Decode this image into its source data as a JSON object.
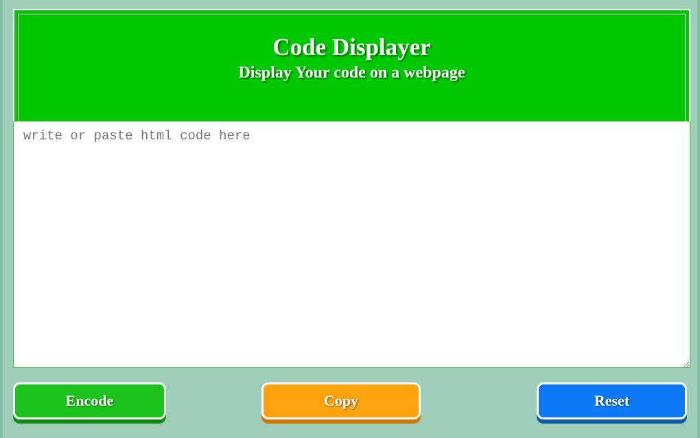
{
  "header": {
    "title": "Code Displayer",
    "subtitle": "Display Your code on a webpage"
  },
  "editor": {
    "placeholder": "write or paste html code here",
    "value": ""
  },
  "buttons": {
    "encode_label": "Encode",
    "copy_label": "Copy",
    "reset_label": "Reset"
  },
  "colors": {
    "page_background": "#9ecdb8",
    "header_background": "#00c800",
    "encode_button": "#1dc41d",
    "copy_button": "#fca30e",
    "reset_button": "#0d79f5"
  }
}
